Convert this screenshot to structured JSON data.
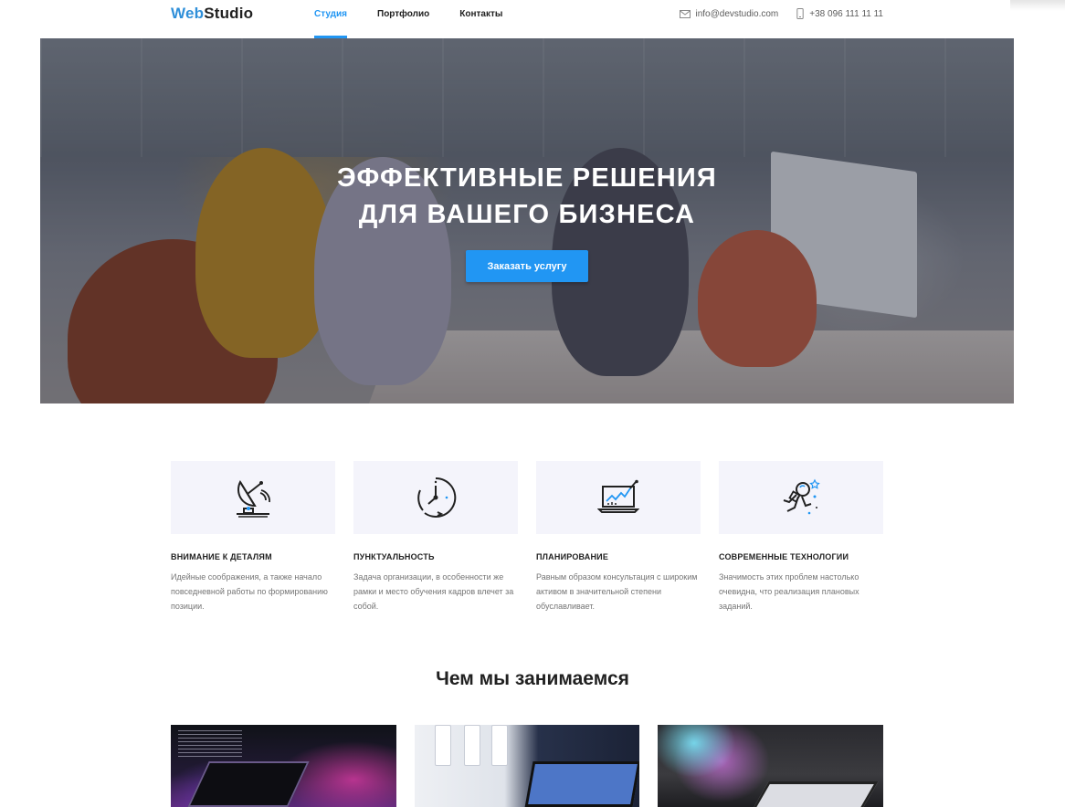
{
  "header": {
    "logo_part1": "Web",
    "logo_part2": "Studio",
    "nav": [
      {
        "label": "Студия",
        "active": true
      },
      {
        "label": "Портфолио",
        "active": false
      },
      {
        "label": "Контакты",
        "active": false
      }
    ],
    "email": "info@devstudio.com",
    "phone": "+38 096 111 11 11",
    "email_icon": "mail-icon",
    "phone_icon": "phone-icon"
  },
  "hero": {
    "title_line1": "ЭФФЕКТИВНЫЕ РЕШЕНИЯ",
    "title_line2": "ДЛЯ ВАШЕГО БИЗНЕСА",
    "button_label": "Заказать услугу"
  },
  "features": [
    {
      "icon": "satellite-dish-icon",
      "title": "ВНИМАНИЕ К ДЕТАЛЯМ",
      "text": "Идейные соображения, а также начало повседневной работы по формированию позиции."
    },
    {
      "icon": "clock-icon",
      "title": "ПУНКТУАЛЬНОСТЬ",
      "text": "Задача организации, в особенности же рамки и место обучения кадров влечет за собой."
    },
    {
      "icon": "laptop-chart-icon",
      "title": "ПЛАНИРОВАНИЕ",
      "text": "Равным образом консультация с широким активом в значительной степени обуславливает."
    },
    {
      "icon": "astronaut-icon",
      "title": "СОВРЕМЕННЫЕ ТЕХНОЛОГИИ",
      "text": "Значимость этих проблем настолько очевидна, что реализация плановых заданий."
    }
  ],
  "services": {
    "title": "Чем мы занимаемся"
  },
  "colors": {
    "accent": "#2196f3",
    "logo_blue": "#2f8fd9",
    "text": "#212121",
    "muted": "#757575",
    "feature_bg": "#f4f4fb"
  }
}
